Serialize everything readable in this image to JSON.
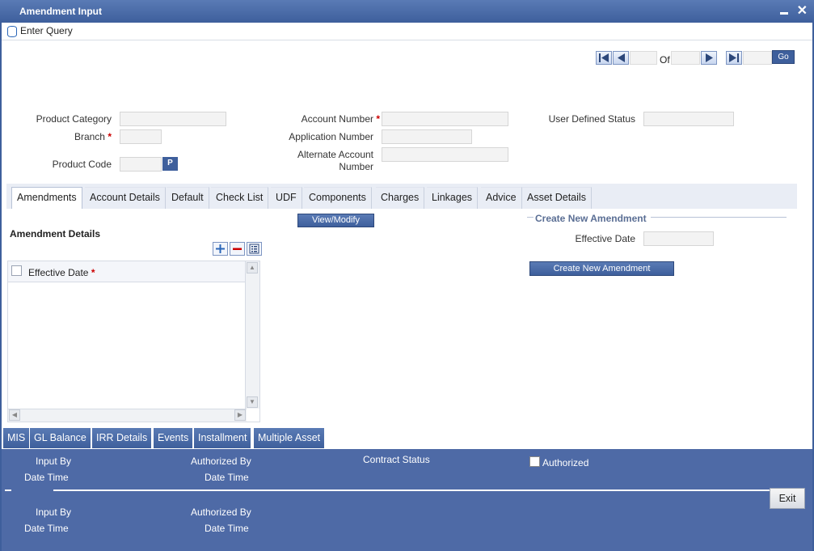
{
  "window": {
    "title": "Amendment Input"
  },
  "toolbar": {
    "enter_query": "Enter Query"
  },
  "nav": {
    "of_label": "Of",
    "go_label": "Go"
  },
  "form": {
    "product_category_label": "Product Category",
    "branch_label": "Branch",
    "product_code_label": "Product Code",
    "p_button": "P",
    "account_number_label": "Account Number",
    "application_number_label": "Application Number",
    "alternate_account_label_1": "Alternate Account",
    "alternate_account_label_2": "Number",
    "user_defined_status_label": "User Defined Status",
    "required_marker": "*"
  },
  "tabs": [
    "Amendments",
    "Account Details",
    "Default",
    "Check List",
    "UDF",
    "Components",
    "Charges",
    "Linkages",
    "Advice",
    "Asset Details"
  ],
  "amendments": {
    "view_modify": "View/Modify",
    "details_title": "Amendment Details",
    "col_effective_date": "Effective Date",
    "create_section_title": "Create New Amendment",
    "effective_date_label": "Effective Date",
    "create_button": "Create New Amendment"
  },
  "bottom_tabs": [
    "MIS",
    "GL Balance",
    "IRR Details",
    "Events",
    "Installment",
    "Multiple Asset"
  ],
  "footer": {
    "input_by": "Input By",
    "date_time": "Date Time",
    "authorized_by": "Authorized By",
    "contract_status": "Contract Status",
    "authorized": "Authorized",
    "exit": "Exit"
  },
  "colors": {
    "brand": "#3e5f9c",
    "footer": "#4e6aa6",
    "required": "#cc0000"
  }
}
